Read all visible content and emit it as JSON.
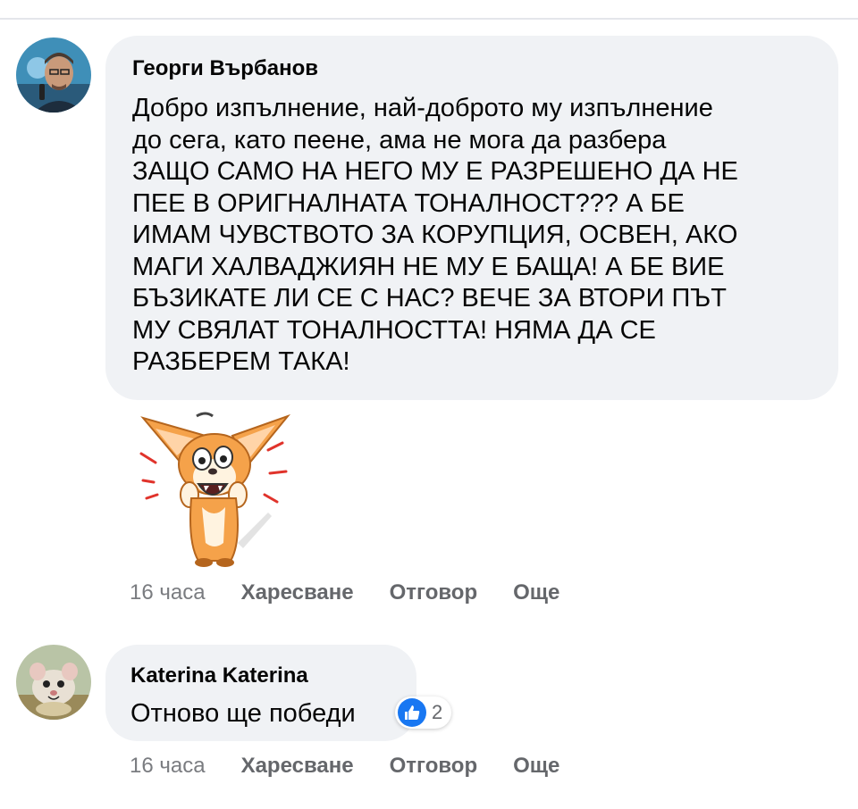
{
  "comments": [
    {
      "author": "Георги Върбанов",
      "text": "Добро изпълнение, най-доброто му изпълнение\nдо сега, като пеене, ама не мога да разбера\nЗАЩО САМО НА НЕГО МУ Е РАЗРЕШЕНО ДА НЕ\nПЕЕ В ОРИГНАЛНАТА ТОНАЛНОСТ??? А БЕ\nИМАМ ЧУВСТВОТО ЗА КОРУПЦИЯ, ОСВЕН, АКО\nМАГИ ХАЛВАДЖИЯН НЕ МУ Е БАЩА! А БЕ ВИЕ\nБЪЗИКАТЕ ЛИ СЕ С НАС? ВЕЧЕ ЗА ВТОРИ ПЪТ\nМУ СВЯЛАТ ТОНАЛНОСТТА! НЯМА ДА СЕ\nРАЗБЕРЕМ ТАКА!",
      "time": "16 часа",
      "like_label": "Харесване",
      "reply_label": "Отговор",
      "more_label": "Още",
      "sticker": "corgi-shocked-sticker"
    },
    {
      "author": "Katerina Katerina",
      "text": "Отново ще победи",
      "time": "16 часа",
      "like_label": "Харесване",
      "reply_label": "Отговор",
      "more_label": "Още",
      "reaction": {
        "icon": "thumbs-up-icon",
        "count": "2"
      }
    }
  ],
  "colors": {
    "bubble": "#f0f2f5",
    "text": "#050505",
    "secondary": "#65676b",
    "like_blue": "#1877f2"
  }
}
